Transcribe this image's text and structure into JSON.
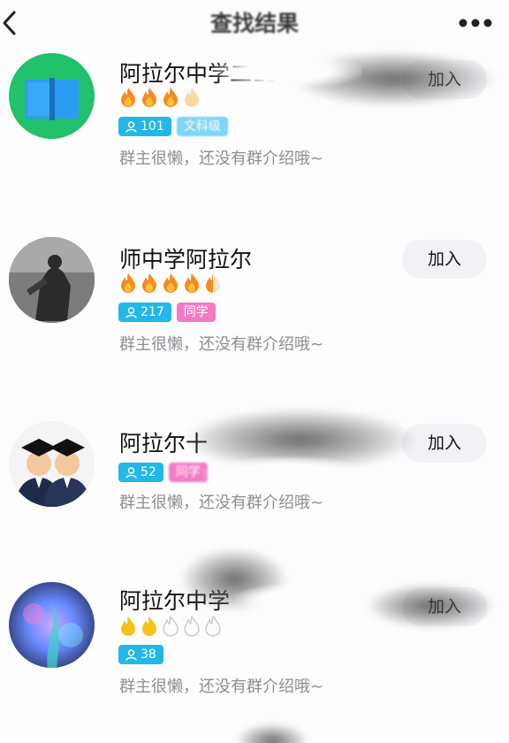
{
  "header": {
    "title": "查找结果",
    "back_icon": "chevron-left-icon",
    "more_icon": "more-dots-icon"
  },
  "groups": [
    {
      "name": "阿拉尔中学二19",
      "level": 3.5,
      "members": "101",
      "tag": "文科级",
      "description": "群主很懒，还没有群介绍哦~",
      "join_label": "加入",
      "avatar": "book-icon"
    },
    {
      "name": "师中学阿拉尔",
      "level": 4.5,
      "members": "217",
      "tag": "同学",
      "description": "群主很懒，还没有群介绍哦~",
      "join_label": "加入",
      "avatar": "statue-photo"
    },
    {
      "name": "阿拉尔十",
      "level": 0,
      "members": "52",
      "tag": "同学",
      "description": "群主很懒，还没有群介绍哦~",
      "join_label": "加入",
      "avatar": "graduates-icon"
    },
    {
      "name": "阿拉尔中学",
      "level": 2,
      "members": "38",
      "tag": "",
      "description": "群主很懒，还没有群介绍哦~",
      "join_label": "加入",
      "avatar": "nebula-photo"
    }
  ],
  "colors": {
    "member_tag": "#22b7e8",
    "type_tag": "#f37bc4",
    "flame_orange": "#f7891f",
    "flame_gold": "#f6c21a",
    "desc_text": "#8e8e93"
  }
}
